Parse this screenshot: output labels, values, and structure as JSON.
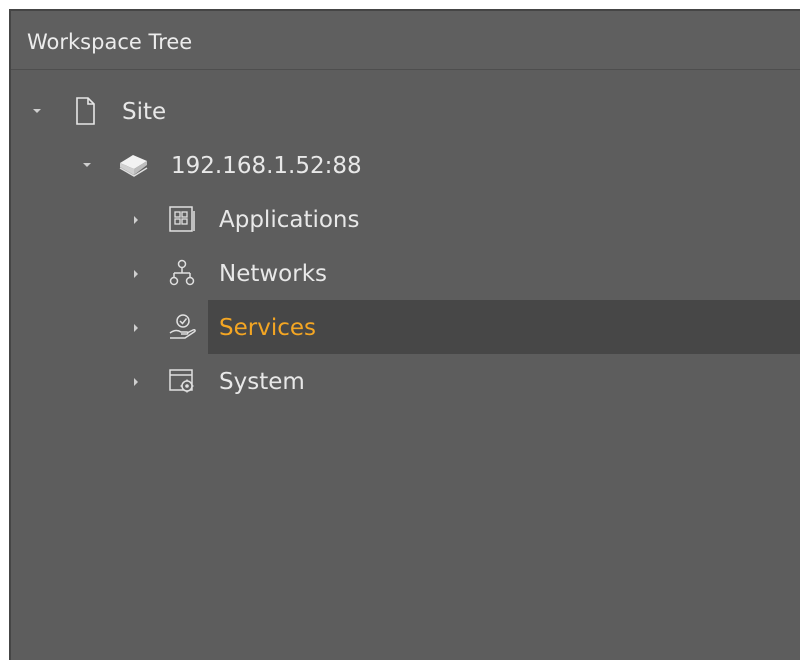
{
  "panel": {
    "title": "Workspace Tree"
  },
  "tree": {
    "items": [
      {
        "label": "Site",
        "icon": "document-icon",
        "expanded": true
      },
      {
        "label": "192.168.1.52:88",
        "icon": "server-stack-icon",
        "expanded": true
      },
      {
        "label": "Applications",
        "icon": "applications-grid-icon",
        "expanded": false
      },
      {
        "label": "Networks",
        "icon": "network-icon",
        "expanded": false
      },
      {
        "label": "Services",
        "icon": "services-hand-icon",
        "expanded": false,
        "selected": true
      },
      {
        "label": "System",
        "icon": "system-gear-icon",
        "expanded": false
      }
    ]
  },
  "colors": {
    "panel_bg": "#5d5d5d",
    "selected_bg": "#474747",
    "selected_text": "#f4a623",
    "text": "#e8e8e8"
  }
}
